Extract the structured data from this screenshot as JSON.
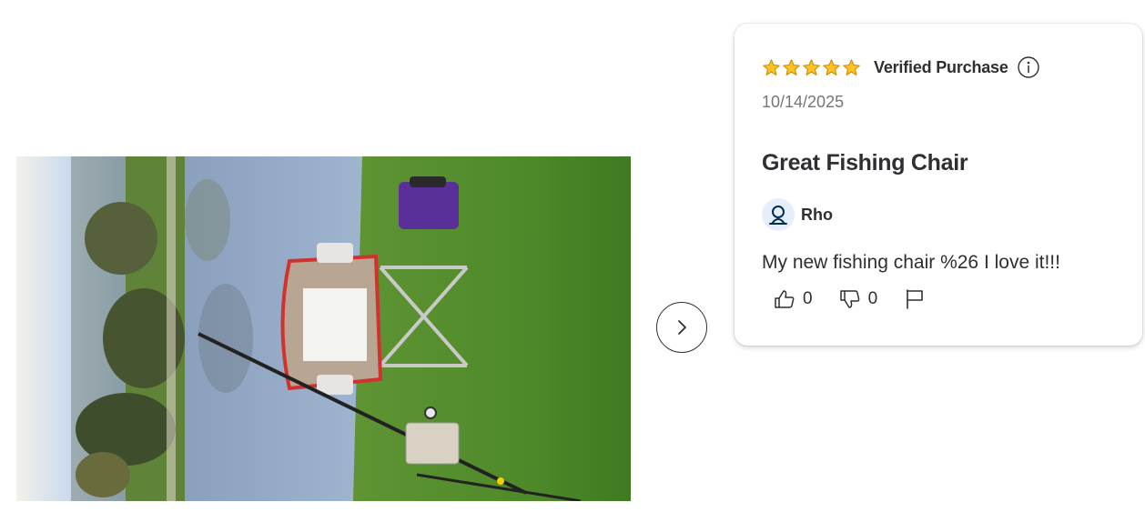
{
  "photo": {
    "alt": "Customer photo of a folding fishing chair on grass by a lake"
  },
  "carousel": {
    "next_icon": "chevron-right-icon"
  },
  "review": {
    "rating": 5,
    "rating_max": 5,
    "star_color": "#ffc220",
    "verified_label": "Verified Purchase",
    "info_icon": "info-circle-icon",
    "date": "10/14/2025",
    "title": "Great Fishing Chair",
    "reviewer_icon": "user-icon",
    "reviewer": "Rho",
    "text": "My new fishing chair %26 I love it!!!",
    "helpful_count": "0",
    "not_helpful_count": "0",
    "report_icon": "flag-icon"
  },
  "colors": {
    "text": "#2e2f32",
    "muted": "#74767c",
    "avatar_bg": "#e5eefa",
    "avatar_icon": "#0071dc"
  }
}
